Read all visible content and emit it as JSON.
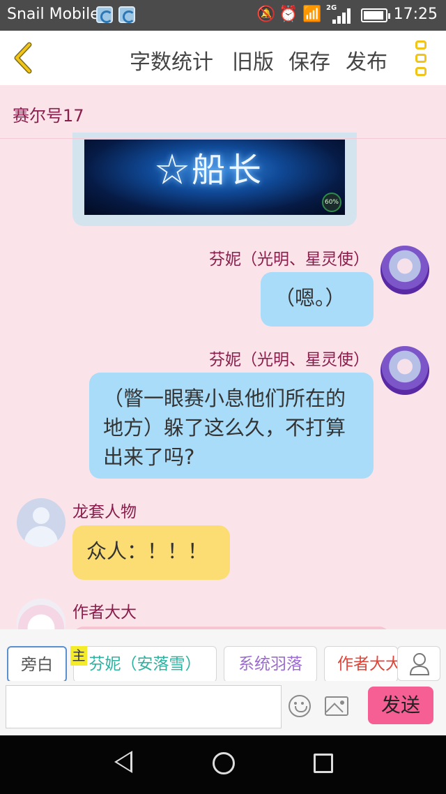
{
  "status_bar": {
    "carrier": "Snail Mobile",
    "network": "2G",
    "time": "17:25"
  },
  "toolbar": {
    "word_count": "字数统计",
    "old_version": "旧版",
    "save": "保存",
    "publish": "发布"
  },
  "chat": {
    "title": "赛尔号17",
    "image_caption": "☆船长",
    "image_progress": "60%",
    "messages": [
      {
        "sender": "芬妮（光明、星灵使）",
        "text": "（嗯。）"
      },
      {
        "sender": "芬妮（光明、星灵使）",
        "text": "（瞥一眼赛小息他们所在的地方）躲了这么久，不打算出来了吗?"
      },
      {
        "sender": "龙套人物",
        "text": "众人：！！！"
      },
      {
        "sender": "作者大大",
        "text": ""
      }
    ]
  },
  "roles": {
    "narration": "旁白",
    "main_tag": "主",
    "fenni": "芬妮（安落雪）",
    "system": "系统羽落",
    "author": "作者大大"
  },
  "colors": {
    "role_fenni": "#2db2a0",
    "role_system": "#9c6bd2",
    "role_author": "#e0453a",
    "send_button": "#f55f94",
    "sender_name": "#8a1d4b"
  },
  "input": {
    "placeholder": "",
    "send": "发送"
  }
}
